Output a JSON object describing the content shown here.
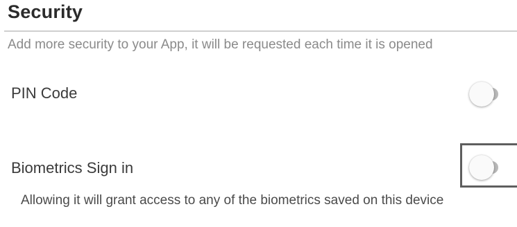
{
  "security": {
    "title": "Security",
    "description": "Add more security to your App, it will be requested each time it is opened"
  },
  "pin_code": {
    "label": "PIN Code",
    "enabled": false
  },
  "biometrics": {
    "label": "Biometrics Sign in",
    "enabled": false,
    "description": "Allowing it will grant access to any of the biometrics saved on this device"
  },
  "colors": {
    "title": "#2b2b2b",
    "description": "#8a8a8a",
    "toggle_track_off": "#b8b8b8",
    "toggle_thumb_off": "#fafafa",
    "highlight": "#5e5e5e"
  }
}
